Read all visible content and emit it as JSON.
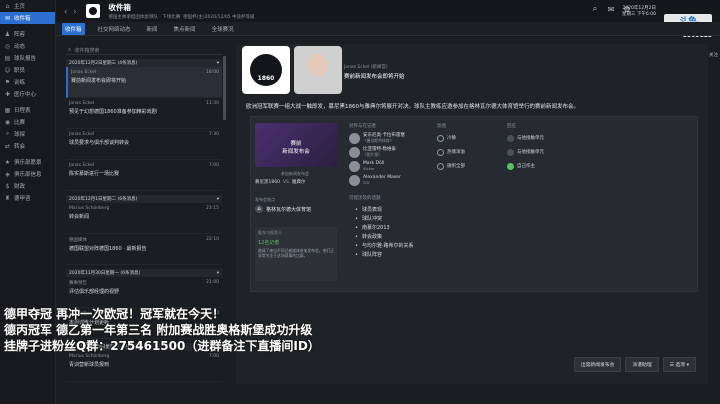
{
  "sidebar": {
    "items": [
      {
        "label": "主页",
        "icon": "home-icon"
      },
      {
        "label": "收件箱",
        "icon": "inbox-icon",
        "active": true
      },
      {
        "label": "阵容",
        "icon": "squad-icon"
      },
      {
        "label": "动态",
        "icon": "dynamics-icon"
      },
      {
        "label": "球队报告",
        "icon": "report-icon"
      },
      {
        "label": "职员",
        "icon": "staff-icon"
      },
      {
        "label": "训练",
        "icon": "training-icon"
      },
      {
        "label": "医疗中心",
        "icon": "medical-icon"
      },
      {
        "label": "日程表",
        "icon": "calendar-icon"
      },
      {
        "label": "比赛",
        "icon": "match-icon"
      },
      {
        "label": "球探",
        "icon": "scouting-icon"
      },
      {
        "label": "转会",
        "icon": "transfer-icon"
      },
      {
        "label": "俱乐部愿景",
        "icon": "vision-icon"
      },
      {
        "label": "俱乐部信息",
        "icon": "club-icon"
      },
      {
        "label": "财政",
        "icon": "finance-icon"
      },
      {
        "label": "德甲咨",
        "icon": "league-icon"
      }
    ]
  },
  "topbar": {
    "title": "收件箱",
    "subtitle": "德国主帅承担团体副领队 · 下场比赛: 德国杯(主)2020/12/05 中途杯等级",
    "date_line1": "2020年12月2日",
    "date_line2": "星期三 下午6:00",
    "continue_label": "继续"
  },
  "tabs": [
    "收件箱",
    "社交网络动态",
    "新闻",
    "焦点新闻",
    "全球赛况"
  ],
  "logo": {
    "name": "斗鱼",
    "sub": "房间号",
    "number": "8909115",
    "follow": "关注"
  },
  "search": {
    "placeholder": "收件箱搜索"
  },
  "groups": [
    {
      "label": "2020年12月2日星期三 (4条消息)",
      "count": "4"
    },
    {
      "label": "2020年12月1日星期二 (6条消息)",
      "count": "6"
    },
    {
      "label": "2020年11月30日星期一 (6条消息)",
      "count": "6"
    },
    {
      "label": "2020年11月29日星期日 (3条消息)",
      "count": "3"
    }
  ],
  "messages": [
    {
      "from": "Jonas Eckel",
      "subject": "赛前新闻发布会即将开始",
      "time": "18:00",
      "selected": true
    },
    {
      "from": "Jonas Eckel",
      "subject": "预见于幻想德国1860准备参加精彩戏剧",
      "time": "11:30"
    },
    {
      "from": "Jonas Eckel",
      "subject": "球员要求与俱乐部谈判转会",
      "time": "7:30"
    },
    {
      "from": "Jonas Eckel",
      "subject": "陈实慕斯进行一场比赛",
      "time": "7:00"
    },
    {
      "from": "Marius Schönberg",
      "subject": "转会新闻",
      "time": "23:15"
    },
    {
      "from": "德国媒体",
      "subject": "德国联盟对阵德国1860 · 最新报告",
      "time": "22:10"
    },
    {
      "from": "赛事预告",
      "subject": "评估俱乐部经理的视野",
      "time": "21:00"
    },
    {
      "from": "球队助理",
      "subject": "本周训练计划更新",
      "time": "8:00"
    },
    {
      "from": "Marius Schönberg",
      "subject": "青训营新球员报到",
      "time": "7:00"
    }
  ],
  "detail": {
    "crest_text": "1860",
    "sender_role": "Jonas Eckel (新闻官)",
    "title": "赛前新闻发布会即将开始",
    "body": "欧洲冠军联赛一组大战一触即发，慕尼黑1860与雅典尔将展开对决。球队主教练应邀参加在格林瓦尔德大体育馆举行的赛前新闻发布会。",
    "event_image_text": "赛前\n新闻发布会",
    "teams_label": "参加新闻发布会",
    "home_team": "慕尼黑1860",
    "vs": "VS",
    "away_team": "雅典尔",
    "place_label": "发布会地点",
    "place": "格林瓦尔德大体育馆",
    "note_title": "股东与投资人",
    "note_value": "12名记者",
    "note_desc": "邀请了来自不同记者媒体参加发布会，他们正非常关注于这场赛事的比赛。",
    "journalists_head": "对阵与在记者",
    "mood_head": "氛围",
    "resp_head": "回应",
    "journalists": [
      {
        "name": "安东尼奥·卡拉布雷塞",
        "outlet": "《曼彻斯特体育》"
      },
      {
        "name": "比亚雷特·勒维泰",
        "outlet": "《图片报》"
      },
      {
        "name": "Mark Döll",
        "outlet": "Kicker"
      },
      {
        "name": "Alexander Maser",
        "outlet": "SID"
      }
    ],
    "moods": [
      "冷静",
      "热情洋溢",
      "旗帜全部"
    ],
    "responses": [
      "与他接触单元",
      "与他接触单元",
      "自己作主"
    ],
    "topics_head": "可能涉及的话题",
    "topics": [
      "球员表现",
      "球队冲突",
      "南慕尔2013",
      "转会政策",
      "与均尔雅·路希尔的关系",
      "球队阵容"
    ]
  },
  "buttons": {
    "press": "出席新闻发布会",
    "delegate": "派遣助理",
    "options": "选项"
  },
  "overlay": {
    "line1": "德甲夺冠 再冲一次欧冠！冠军就在今天！",
    "line2": "德丙冠军 德乙第一年第三名 附加赛战胜奥格斯堡成功升级",
    "line3": "挂牌子进粉丝Q群：275461500（进群备注下直播间ID）"
  },
  "colors": {
    "accent": "#2c6fd0",
    "positive": "#5cbf63"
  }
}
